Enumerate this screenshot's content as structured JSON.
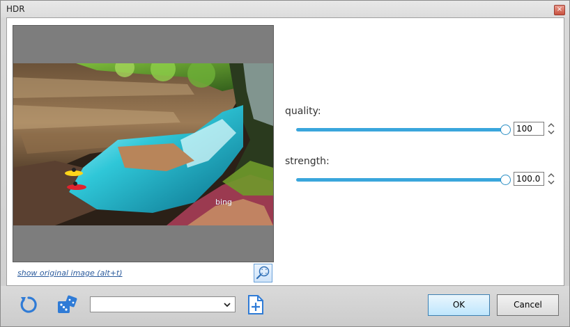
{
  "window": {
    "title": "HDR",
    "close_glyph": "×"
  },
  "preview": {
    "watermark": "bing",
    "show_original_link": "show original image (alt+t)"
  },
  "sliders": {
    "quality": {
      "label": "quality:",
      "value": "100",
      "level": 1.0
    },
    "strength": {
      "label": "strength:",
      "value": "100.0",
      "level": 1.0
    }
  },
  "toolbar": {
    "reset_icon": "refresh-icon",
    "random_icon": "dice-icon",
    "preset_value": "",
    "add_preset_icon": "add-file-icon"
  },
  "buttons": {
    "ok_label": "OK",
    "cancel_label": "Cancel"
  },
  "colors": {
    "accent": "#3aa6dc",
    "link": "#2a5a9c",
    "icon_blue": "#2f7bd6"
  }
}
